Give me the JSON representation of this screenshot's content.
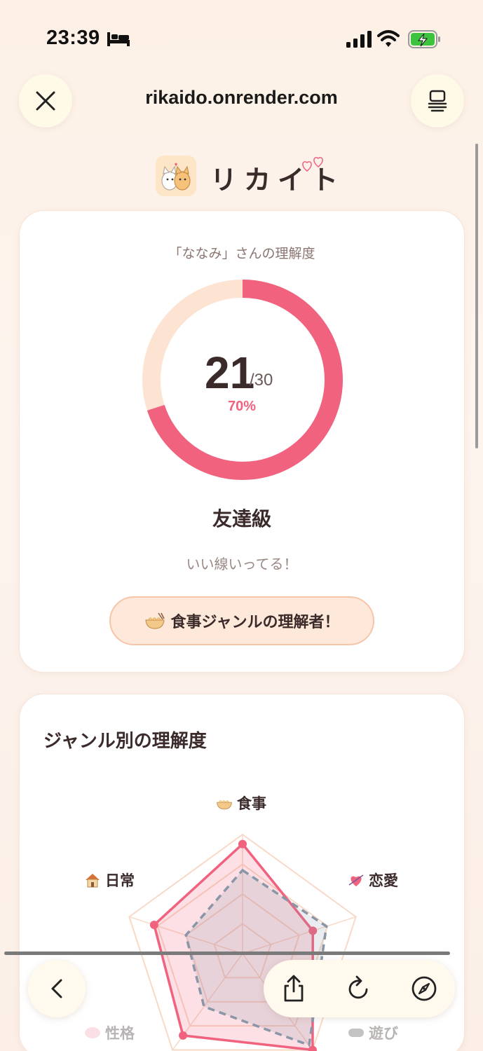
{
  "status_bar": {
    "time": "23:39",
    "icons": [
      "bed-icon",
      "signal-icon",
      "wifi-icon",
      "battery-charging-icon"
    ]
  },
  "browser": {
    "url": "rikaido.onrender.com",
    "close_icon": "close-icon",
    "tabs_icon": "tabs-icon"
  },
  "brand": {
    "name": "リカイト",
    "logo_icon": "cats-logo-icon",
    "decor_icon": "hearts-icon"
  },
  "score_card": {
    "caption": "「ななみ」さんの理解度",
    "score": "21",
    "total": "/30",
    "percent_text": "70%",
    "percent_value": 70,
    "rank": "友達級",
    "comment": "いい線いってる！",
    "badge_text": "食事ジャンルの理解者！",
    "badge_icon": "noodle-bowl-icon",
    "colors": {
      "accent": "#f0627e",
      "track": "#fde3d2"
    }
  },
  "genre_card": {
    "title": "ジャンル別の理解度",
    "axes": [
      {
        "label": "食事",
        "icon": "noodle-bowl-icon"
      },
      {
        "label": "恋愛",
        "icon": "heart-arrow-icon"
      },
      {
        "label": "遊び",
        "icon": "gamepad-icon"
      },
      {
        "label": "性格",
        "icon": "brain-icon"
      },
      {
        "label": "日常",
        "icon": "house-icon"
      }
    ]
  },
  "chart_data": {
    "type": "radar",
    "categories": [
      "食事",
      "恋愛",
      "遊び",
      "性格",
      "日常"
    ],
    "series": [
      {
        "values": [
          0.92,
          0.62,
          1.0,
          0.85,
          0.78
        ],
        "color": "#f0627e",
        "style": "solid"
      },
      {
        "values": [
          0.7,
          0.74,
          0.95,
          0.55,
          0.5
        ],
        "color": "#8a96a8",
        "style": "dashed"
      }
    ]
  },
  "toolbar": {
    "back_icon": "chevron-left-icon",
    "share_icon": "share-icon",
    "reload_icon": "reload-icon",
    "compass_icon": "compass-icon"
  }
}
